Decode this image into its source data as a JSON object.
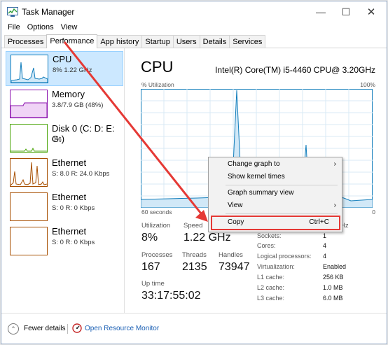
{
  "window": {
    "title": "Task Manager",
    "min_icon": "—",
    "max_icon": "☐",
    "close_icon": "✕"
  },
  "menu": [
    "File",
    "Options",
    "View"
  ],
  "tabs": [
    "Processes",
    "Performance",
    "App history",
    "Startup",
    "Users",
    "Details",
    "Services"
  ],
  "active_tab": "Performance",
  "sidebar": [
    {
      "name": "CPU",
      "sub": "8% 1.22 GHz",
      "color": "#117dbb",
      "selected": true
    },
    {
      "name": "Memory",
      "sub": "3.8/7.9 GB (48%)",
      "color": "#8b12ae",
      "selected": false
    },
    {
      "name": "Disk 0 (C: D: E: G:)",
      "sub": "0%",
      "color": "#4da60c",
      "selected": false
    },
    {
      "name": "Ethernet",
      "sub": "S: 8.0  R: 24.0 Kbps",
      "color": "#a74f01",
      "selected": false
    },
    {
      "name": "Ethernet",
      "sub": "S: 0  R: 0 Kbps",
      "color": "#a74f01",
      "selected": false
    },
    {
      "name": "Ethernet",
      "sub": "S: 0  R: 0 Kbps",
      "color": "#a74f01",
      "selected": false
    }
  ],
  "cpu": {
    "title": "CPU",
    "model": "Intel(R) Core(TM) i5-4460 CPU@ 3.20GHz",
    "util_label": "% Utilization",
    "util_max": "100%",
    "axis_left": "60 seconds",
    "axis_right": "0",
    "utilization_label": "Utilization",
    "utilization": "8%",
    "speed_label": "Speed",
    "speed": "1.22 GHz",
    "processes_label": "Processes",
    "processes": "167",
    "threads_label": "Threads",
    "threads": "2135",
    "handles_label": "Handles",
    "handles": "73947",
    "uptime_label": "Up time",
    "uptime": "33:17:55:02",
    "partial_max_speed": "Hz"
  },
  "cpu_details": [
    {
      "k": "Sockets:",
      "v": "1"
    },
    {
      "k": "Cores:",
      "v": "4"
    },
    {
      "k": "Logical processors:",
      "v": "4"
    },
    {
      "k": "Virtualization:",
      "v": "Enabled"
    },
    {
      "k": "L1 cache:",
      "v": "256 KB"
    },
    {
      "k": "L2 cache:",
      "v": "1.0 MB"
    },
    {
      "k": "L3 cache:",
      "v": "6.0 MB"
    }
  ],
  "context_menu": {
    "change_graph": "Change graph to",
    "kernel_times": "Show kernel times",
    "summary_view": "Graph summary view",
    "view": "View",
    "copy": "Copy",
    "copy_shortcut": "Ctrl+C",
    "submenu_arrow": "›"
  },
  "bottom": {
    "fewer_details": "Fewer details",
    "open_monitor": "Open Resource Monitor",
    "fewer_icon": "⌃"
  },
  "colors": {
    "cpu_line": "#117dbb",
    "grid": "#d9eaf4",
    "annotation": "#e53935",
    "link": "#1a5fb4"
  }
}
